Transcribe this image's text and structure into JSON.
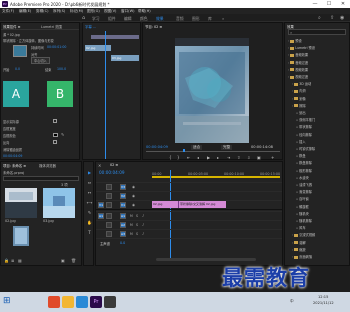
{
  "window": {
    "title": "Adobe Premiere Pro 2020 - D:\\pb6新时代发展规划 *",
    "controls": [
      "—",
      "☐",
      "✕"
    ]
  },
  "menu": [
    "文件(F)",
    "编辑(E)",
    "剪辑(C)",
    "序列(S)",
    "标记(M)",
    "图形(G)",
    "视图(V)",
    "窗口(W)",
    "帮助(H)"
  ],
  "workspace": {
    "tabs": [
      "学习",
      "组件",
      "编辑",
      "颜色",
      "效果",
      "音频",
      "图形",
      "库"
    ],
    "active_index": 4,
    "more": "»"
  },
  "effect_controls": {
    "tabs": [
      "效果控件 ≡",
      "Lumetri 范围"
    ],
    "source": "源 * 02.jpg",
    "sequence": "01 * 02.jpg",
    "effect_name": "带状擦除 · 立方体旋转，图像与形变",
    "start_label": "开始",
    "end_label": "结束",
    "tile_a": "A",
    "tile_b": "B",
    "duration_label": "持续时间",
    "duration_value": "00:00:01:00",
    "alignment_label": "对齐",
    "alignment_value": "中心切入",
    "start_value": "0.0",
    "end_value": "100.0",
    "show_actual_sources": "显示实际源",
    "border_width": "边框宽度",
    "border_color": "边框颜色",
    "reverse": "反向",
    "antialias": "消除锯齿品质",
    "timecode": "00:00:04:09"
  },
  "ec_timeline": {
    "tab": "字幕 …",
    "clip_a": "02.jpg",
    "clip_b": "03.jpg"
  },
  "program": {
    "tab": "节目: 02 ≡",
    "timecode_left": "00:00:04:09",
    "fit": "适合",
    "timecode_right": "00:00:14:08",
    "quality": "完整"
  },
  "effects_panel": {
    "tab": "效果",
    "search_placeholder": "",
    "items": [
      {
        "label": "预设",
        "indent": 0
      },
      {
        "label": "Lumetri 预设",
        "indent": 0
      },
      {
        "label": "音频效果",
        "indent": 0
      },
      {
        "label": "音频过渡",
        "indent": 0
      },
      {
        "label": "视频效果",
        "indent": 0
      },
      {
        "label": "视频过渡",
        "indent": 0
      },
      {
        "label": "3D 运动",
        "indent": 1
      },
      {
        "label": "内滑",
        "indent": 1
      },
      {
        "label": "划像",
        "indent": 1
      },
      {
        "label": "擦除",
        "indent": 1
      },
      {
        "label": "划出",
        "indent": 2
      },
      {
        "label": "双侧平推门",
        "indent": 2
      },
      {
        "label": "带状擦除",
        "indent": 2
      },
      {
        "label": "径向擦除",
        "indent": 2
      },
      {
        "label": "插入",
        "indent": 2
      },
      {
        "label": "时钟式擦除",
        "indent": 2
      },
      {
        "label": "棋盘",
        "indent": 2
      },
      {
        "label": "棋盘擦除",
        "indent": 2
      },
      {
        "label": "楔形擦除",
        "indent": 2
      },
      {
        "label": "水波块",
        "indent": 2
      },
      {
        "label": "油漆飞溅",
        "indent": 2
      },
      {
        "label": "渐变擦除",
        "indent": 2
      },
      {
        "label": "百叶窗",
        "indent": 2
      },
      {
        "label": "螺旋框",
        "indent": 2
      },
      {
        "label": "随机块",
        "indent": 2
      },
      {
        "label": "随机擦除",
        "indent": 2
      },
      {
        "label": "风车",
        "indent": 2
      },
      {
        "label": "沉浸式视频",
        "indent": 1
      },
      {
        "label": "溶解",
        "indent": 1
      },
      {
        "label": "缩放",
        "indent": 1
      },
      {
        "label": "页面剥落",
        "indent": 1
      }
    ]
  },
  "project": {
    "tabs": [
      "项目: 未命名 ≡",
      "媒体浏览器"
    ],
    "name": "未命名.prproj",
    "item_count": "3 项",
    "thumb1_label": "02.jpg",
    "thumb2_label": "03.jpg"
  },
  "tools": [
    "▶",
    "⇔",
    "↔",
    "⟷",
    "✎",
    "✋",
    "T"
  ],
  "timeline": {
    "tab": "02 ≡",
    "timecode": "00:00:04:09",
    "ruler": [
      "00:00",
      "00:00:05:00",
      "00:00:10:00",
      "00:00:15:00"
    ],
    "video_tracks": [
      "V3",
      "V2",
      "V1"
    ],
    "audio_tracks": [
      "A1",
      "A2",
      "A3"
    ],
    "master": "主声道",
    "master_value": "0.0",
    "clip_v1_a": "02.jpg",
    "clip_v1_b": "带状擦除/交叉溶解 02.jpg"
  },
  "taskbar": {
    "time": "12:15",
    "date": "2021/11/12",
    "lang": "中"
  },
  "watermark": "最需教育",
  "colors": {
    "accent": "#2d8ceb",
    "tile_a": "#2aa59e",
    "tile_b": "#35b56a",
    "clip": "#d58ad6",
    "folder": "#c9a24a"
  }
}
